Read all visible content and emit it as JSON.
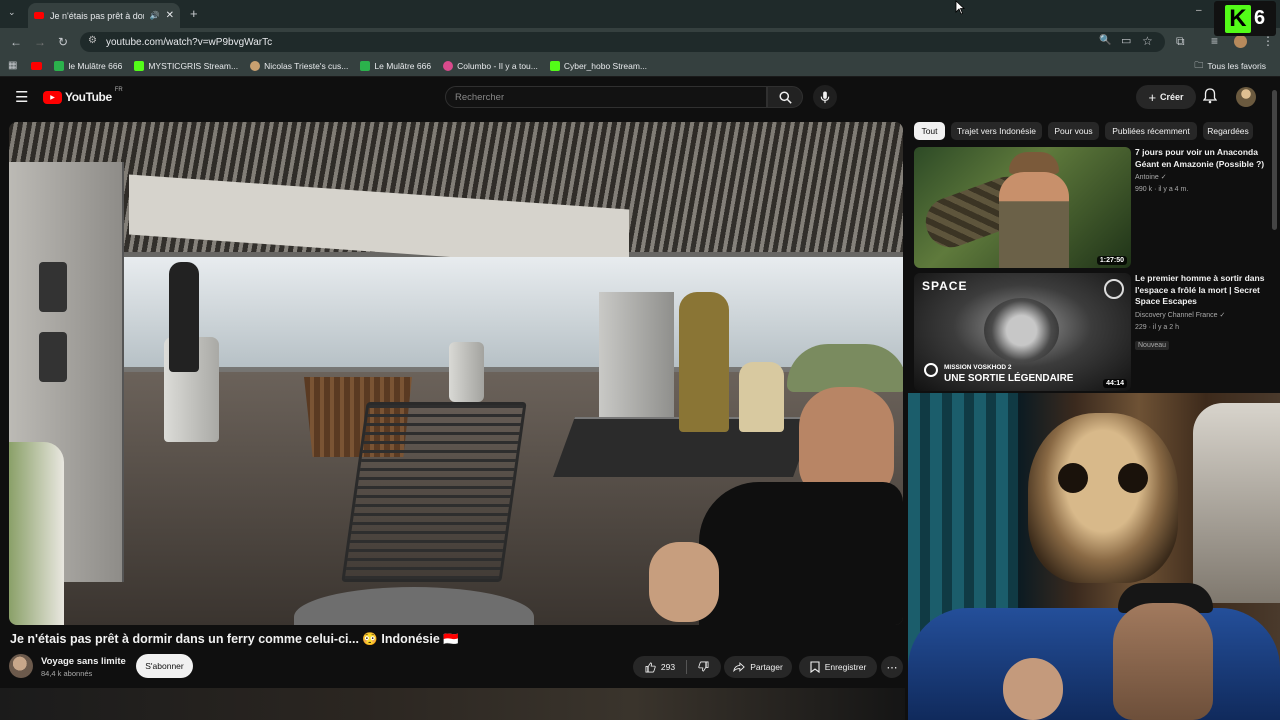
{
  "browser": {
    "tab_title": "Je n'étais pas prêt à dormir",
    "url": "youtube.com/watch?v=wP9bvgWarTc",
    "bookmarks": [
      {
        "label": "le Mulâtre 666",
        "color": "#2bb24c"
      },
      {
        "label": "MYSTICGRIS Stream...",
        "color": "#53fc18"
      },
      {
        "label": "Nicolas Trieste's cus...",
        "color": "#c8a070"
      },
      {
        "label": "Le Mulâtre 666",
        "color": "#2bb24c"
      },
      {
        "label": "Columbo - Il y a tou...",
        "color": "#d94a8c"
      },
      {
        "label": "Cyber_hobo Stream...",
        "color": "#53fc18"
      }
    ],
    "favorites_label": "Tous les favoris"
  },
  "youtube": {
    "logo_text": "YouTube",
    "logo_region": "FR",
    "search_placeholder": "Rechercher",
    "create_label": "Créer"
  },
  "video": {
    "title": "Je n'étais pas prêt à dormir dans un ferry comme celui-ci... 😳 Indonésie 🇮🇩",
    "channel": "Voyage sans limite",
    "subscribers": "84,4 k abonnés",
    "subscribe_label": "S'abonner",
    "likes": "293",
    "share_label": "Partager",
    "save_label": "Enregistrer"
  },
  "chips": [
    "Tout",
    "Trajet vers Indonésie",
    "Pour vous",
    "Publiées récemment",
    "Regardées"
  ],
  "recommendations": [
    {
      "title": "7 jours pour voir un Anaconda Géant en Amazonie (Possible ?)",
      "channel": "Antoine",
      "meta": "990 k · il y a 4 m.",
      "duration": "1:27:50"
    },
    {
      "title": "Le premier homme à sortir dans l'espace a frôlé la mort | Secret Space Escapes",
      "channel": "Discovery Channel France",
      "meta": "229 · il y a 2 h",
      "badge": "Nouveau",
      "duration": "44:14",
      "thumb_top": "SPACE",
      "thumb_caption_small": "MISSION VOSKHOD 2",
      "thumb_caption": "UNE SORTIE LÉGENDAIRE"
    }
  ],
  "overlay": {
    "k_letter": "K",
    "k_number": "6"
  }
}
